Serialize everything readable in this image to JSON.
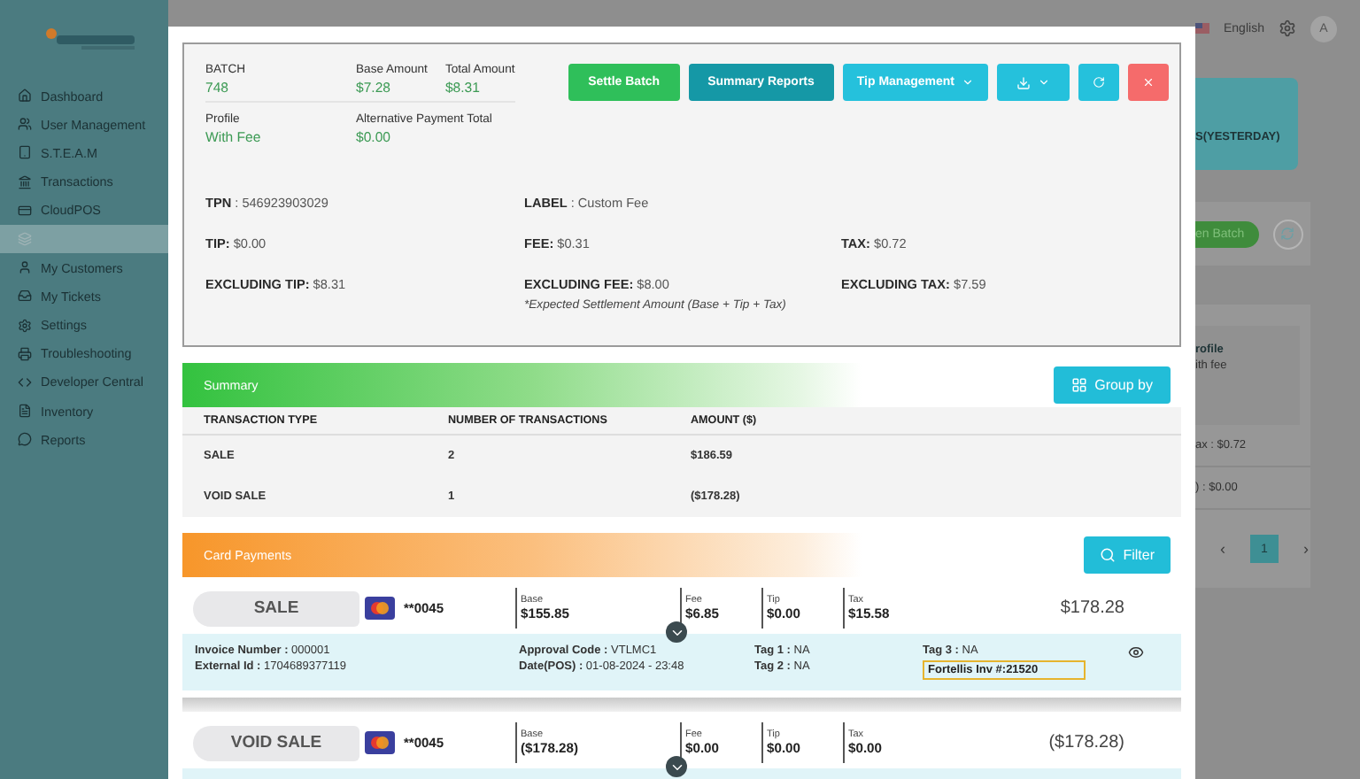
{
  "sidebar": {
    "items": [
      {
        "label": "Dashboard",
        "selected": false
      },
      {
        "label": "User Management",
        "selected": false
      },
      {
        "label": "S.T.E.A.M",
        "selected": false
      },
      {
        "label": "Transactions",
        "selected": false
      },
      {
        "label": "CloudPOS",
        "selected": false
      },
      {
        "selected": true
      },
      {
        "label": "My Customers",
        "selected": false
      },
      {
        "label": "My Tickets",
        "selected": false
      },
      {
        "label": "Settings",
        "selected": false
      },
      {
        "label": "Troubleshooting",
        "selected": false
      },
      {
        "label": "Developer Central",
        "selected": false
      },
      {
        "label": "Inventory",
        "selected": false
      },
      {
        "label": "Reports",
        "selected": false
      }
    ]
  },
  "topbar": {
    "language": "English",
    "avatar": "A"
  },
  "background": {
    "period_card": {
      "text": "S(YESTERDAY)"
    },
    "batch_card": {
      "button": "en Batch"
    },
    "profile_card": {
      "title": "rofile",
      "subtitle": "ith fee",
      "rows": [
        "ax : $0.72",
        ") : $0.00"
      ],
      "pagination": {
        "prev": "‹",
        "pages": [
          {
            "label": "1",
            "selected": true
          }
        ],
        "next": "›"
      }
    }
  },
  "modal": {
    "batch_header": {
      "info_rows": [
        [
          {
            "label": "BATCH",
            "value": "748"
          },
          {
            "label": "Base Amount",
            "value": "$7.28"
          },
          {
            "label": "Total Amount",
            "value": "$8.31"
          }
        ],
        [
          {
            "label": "Profile",
            "value": "With Fee"
          },
          {
            "label": "Alternative Payment Total",
            "value": "$0.00"
          }
        ]
      ],
      "actions": [
        {
          "kind": "text",
          "label": "Settle Batch",
          "color": "#2fbf5a"
        },
        {
          "kind": "text",
          "label": "Summary Reports",
          "color": "#1598a6"
        },
        {
          "kind": "menu",
          "label": "Tip Management",
          "color": "#25c1dc"
        },
        {
          "kind": "download",
          "color": "#25c1dc"
        },
        {
          "kind": "refresh",
          "color": "#25c1dc"
        },
        {
          "kind": "close",
          "color": "#f56b6b"
        }
      ],
      "details": [
        [
          "**TPN** : 546923903029",
          "**LABEL** : Custom Fee"
        ],
        [
          "**TIP:** $0.00",
          "**FEE:** $0.31",
          "**TAX:** $0.72"
        ],
        [
          "**EXCLUDING TIP:** $8.31",
          "**EXCLUDING FEE:** $8.00",
          "**EXCLUDING TAX:** $7.59"
        ]
      ],
      "note": "*Expected Settlement Amount (Base + Tip + Tax)"
    },
    "summary": {
      "title": "Summary",
      "button": "Group by",
      "columns": [
        "TRANSACTION TYPE",
        "NUMBER OF TRANSACTIONS",
        "AMOUNT ($)"
      ],
      "rows": [
        [
          "SALE",
          "2",
          "$186.59"
        ],
        [
          "VOID SALE",
          "1",
          "($178.28)"
        ]
      ]
    },
    "card_payments": {
      "title": "Card Payments",
      "button": "Filter",
      "transactions": [
        {
          "type": "SALE",
          "card": "**0045",
          "amounts": [
            {
              "label": "Base",
              "value": "$155.85"
            },
            {
              "label": "Fee",
              "value": "$6.85"
            },
            {
              "label": "Tip",
              "value": "$0.00"
            },
            {
              "label": "Tax",
              "value": "$15.58"
            }
          ],
          "total": "$178.28",
          "details": [
            [
              "**Invoice Number :** 000001",
              "**External Id :** 1704689377119"
            ],
            [
              "**Approval Code :** VTLMC1",
              "**Date(POS) :** 01-08-2024 - 23:48"
            ],
            [
              "**Tag 1 :** NA",
              "**Tag 2 :** NA"
            ],
            [
              "**Tag 3 :** NA"
            ]
          ],
          "highlight": "Fortellis Inv #:21520"
        },
        {
          "type": "VOID SALE",
          "card": "**0045",
          "amounts": [
            {
              "label": "Base",
              "value": "($178.28)"
            },
            {
              "label": "Fee",
              "value": "$0.00"
            },
            {
              "label": "Tip",
              "value": "$0.00"
            },
            {
              "label": "Tax",
              "value": "$0.00"
            }
          ],
          "total": "($178.28)"
        }
      ]
    }
  }
}
